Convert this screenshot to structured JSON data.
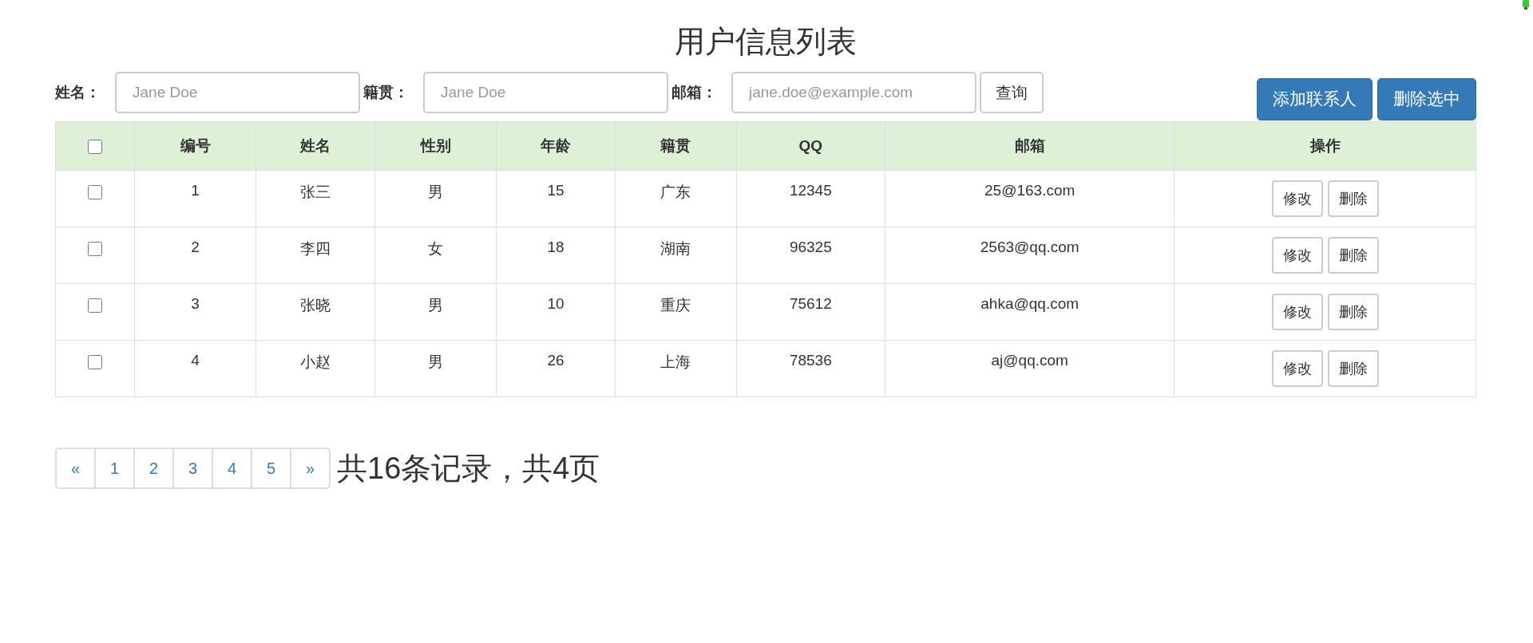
{
  "title": "用户信息列表",
  "search": {
    "fields": [
      {
        "label": "姓名：",
        "placeholder": "Jane Doe"
      },
      {
        "label": "籍贯：",
        "placeholder": "Jane Doe"
      },
      {
        "label": "邮箱：",
        "placeholder": "jane.doe@example.com"
      }
    ],
    "button": "查询"
  },
  "actions": [
    "添加联系人",
    "删除选中"
  ],
  "table": {
    "select_all": {
      "checked": false
    },
    "columns": [
      "编号",
      "姓名",
      "性别",
      "年龄",
      "籍贯",
      "QQ",
      "邮箱",
      "操作"
    ],
    "rows": [
      {
        "checked": false,
        "cells": [
          "1",
          "张三",
          "男",
          "15",
          "广东",
          "12345",
          "25@163.com"
        ],
        "buttons": [
          "修改",
          "删除"
        ]
      },
      {
        "checked": false,
        "cells": [
          "2",
          "李四",
          "女",
          "18",
          "湖南",
          "96325",
          "2563@qq.com"
        ],
        "buttons": [
          "修改",
          "删除"
        ]
      },
      {
        "checked": false,
        "cells": [
          "3",
          "张晓",
          "男",
          "10",
          "重庆",
          "75612",
          "ahka@qq.com"
        ],
        "buttons": [
          "修改",
          "删除"
        ]
      },
      {
        "checked": false,
        "cells": [
          "4",
          "小赵",
          "男",
          "26",
          "上海",
          "78536",
          "aj@qq.com"
        ],
        "buttons": [
          "修改",
          "删除"
        ]
      }
    ]
  },
  "pagination": {
    "prev": "«",
    "pages": [
      "1",
      "2",
      "3",
      "4",
      "5"
    ],
    "next": "»",
    "summary": "共16条记录，共4页"
  }
}
